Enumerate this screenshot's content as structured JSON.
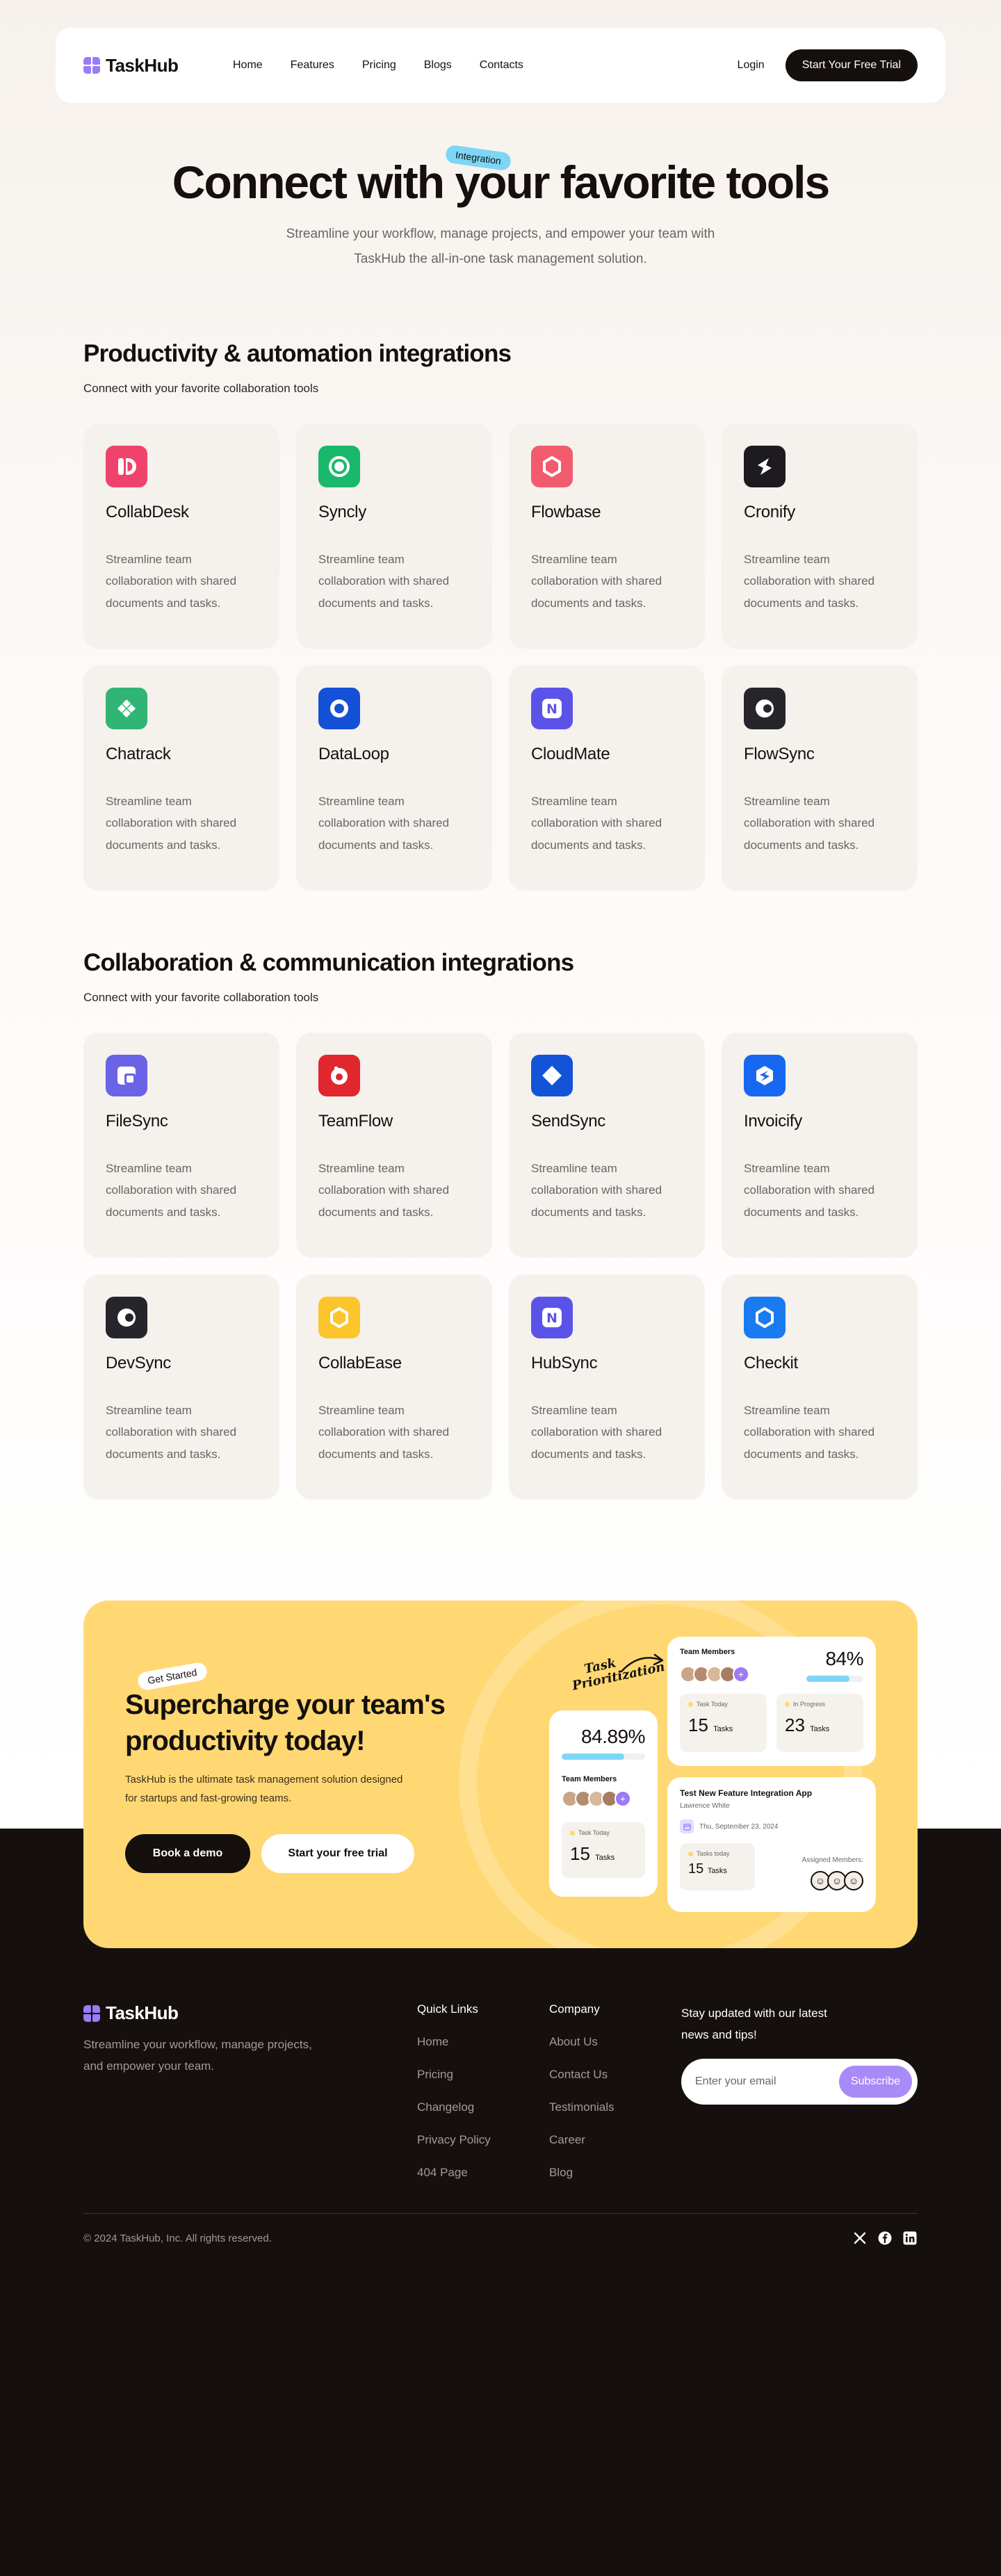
{
  "brand": {
    "name": "TaskHub",
    "accent": "#9b7bf6"
  },
  "nav": {
    "links": [
      "Home",
      "Features",
      "Pricing",
      "Blogs",
      "Contacts"
    ],
    "login": "Login",
    "cta": "Start Your Free Trial"
  },
  "hero": {
    "title": "Connect with your favorite tools",
    "badge": "Integration",
    "subtitle_line1": "Streamline your workflow, manage projects, and empower your team with",
    "subtitle_line2": "TaskHub the all-in-one task management solution."
  },
  "sections": [
    {
      "title": "Productivity & automation integrations",
      "subtitle": "Connect with your favorite collaboration tools",
      "cards": [
        {
          "name": "CollabDesk",
          "icon": "collabdesk-icon",
          "color": "#f0436b",
          "desc": "Streamline team collaboration with shared documents and tasks."
        },
        {
          "name": "Syncly",
          "icon": "syncly-icon",
          "color": "#19b86a",
          "desc": "Streamline team collaboration with shared documents and tasks."
        },
        {
          "name": "Flowbase",
          "icon": "flowbase-icon",
          "color": "#f25b6c",
          "desc": "Streamline team collaboration with shared documents and tasks."
        },
        {
          "name": "Cronify",
          "icon": "cronify-icon",
          "color": "#1d1b1f",
          "desc": "Streamline team collaboration with shared documents and tasks."
        },
        {
          "name": "Chatrack",
          "icon": "chatrack-icon",
          "color": "#31b574",
          "desc": "Streamline team collaboration with shared documents and tasks."
        },
        {
          "name": "DataLoop",
          "icon": "dataloop-icon",
          "color": "#1551d6",
          "desc": "Streamline team collaboration with shared documents and tasks."
        },
        {
          "name": "CloudMate",
          "icon": "cloudmate-icon",
          "color": "#5b53e8",
          "desc": "Streamline team collaboration with shared documents and tasks."
        },
        {
          "name": "FlowSync",
          "icon": "flowsync-icon",
          "color": "#26252b",
          "desc": "Streamline team collaboration with shared documents and tasks."
        }
      ]
    },
    {
      "title": "Collaboration & communication integrations",
      "subtitle": "Connect with your favorite collaboration tools",
      "cards": [
        {
          "name": "FileSync",
          "icon": "filesync-icon",
          "color": "#6a63e6",
          "desc": "Streamline team collaboration with shared documents and tasks."
        },
        {
          "name": "TeamFlow",
          "icon": "teamflow-icon",
          "color": "#e1262d",
          "desc": "Streamline team collaboration with shared documents and tasks."
        },
        {
          "name": "SendSync",
          "icon": "sendsync-icon",
          "color": "#1353d8",
          "desc": "Streamline team collaboration with shared documents and tasks."
        },
        {
          "name": "Invoicify",
          "icon": "invoicify-icon",
          "color": "#1668f0",
          "desc": "Streamline team collaboration with shared documents and tasks."
        },
        {
          "name": "DevSync",
          "icon": "devsync-icon",
          "color": "#26252b",
          "desc": "Streamline team collaboration with shared documents and tasks."
        },
        {
          "name": "CollabEase",
          "icon": "collabease-icon",
          "color": "#fcc52b",
          "desc": "Streamline team collaboration with shared documents and tasks."
        },
        {
          "name": "HubSync",
          "icon": "hubsync-icon",
          "color": "#5b53e8",
          "desc": "Streamline team collaboration with shared documents and tasks."
        },
        {
          "name": "Checkit",
          "icon": "checkit-icon",
          "color": "#1a7af0",
          "desc": "Streamline team collaboration with shared documents and tasks."
        }
      ]
    }
  ],
  "cta": {
    "badge": "Get Started",
    "title_line1": "Supercharge your team's",
    "title_line2": "productivity today!",
    "desc_line1": "TaskHub is the ultimate task management solution designed",
    "desc_line2": "for startups and fast-growing teams.",
    "btn_demo": "Book a demo",
    "btn_trial": "Start your free trial",
    "task_label_1": "Task",
    "task_label_2": "Prioritization",
    "mini_left": {
      "percent": "84.89%",
      "progress": 0.75,
      "members_label": "Team Members",
      "stat_label": "Task Today",
      "stat_num": "15",
      "stat_unit": "Tasks"
    },
    "mini_tr": {
      "members_label": "Team Members",
      "percent": "84%",
      "progress": 0.75,
      "stat1_label": "Task Today",
      "stat1_num": "15",
      "stat1_unit": "Tasks",
      "stat2_label": "In Progress",
      "stat2_num": "23",
      "stat2_unit": "Tasks"
    },
    "mini_br": {
      "title": "Test New Feature Integration App",
      "person": "Lawrence White",
      "date": "Thu, September 23, 2024",
      "stat_label": "Tasks today",
      "stat_num": "15",
      "stat_unit": "Tasks",
      "assigned_label": "Assigned Members:"
    }
  },
  "footer": {
    "brand_desc_line1": "Streamline your workflow, manage projects,",
    "brand_desc_line2": "and empower your team.",
    "quick_links_title": "Quick Links",
    "quick_links": [
      "Home",
      "Pricing",
      "Changelog",
      "Privacy Policy",
      "404 Page"
    ],
    "company_title": "Company",
    "company_links": [
      "About Us",
      "Contact Us",
      "Testimonials",
      "Career",
      "Blog"
    ],
    "news_line1": "Stay updated with our latest",
    "news_line2": "news and tips!",
    "email_placeholder": "Enter your email",
    "subscribe": "Subscribe",
    "copyright": "© 2024 TaskHub, Inc. All rights reserved.",
    "socials": [
      "x-icon",
      "facebook-icon",
      "linkedin-icon"
    ]
  }
}
